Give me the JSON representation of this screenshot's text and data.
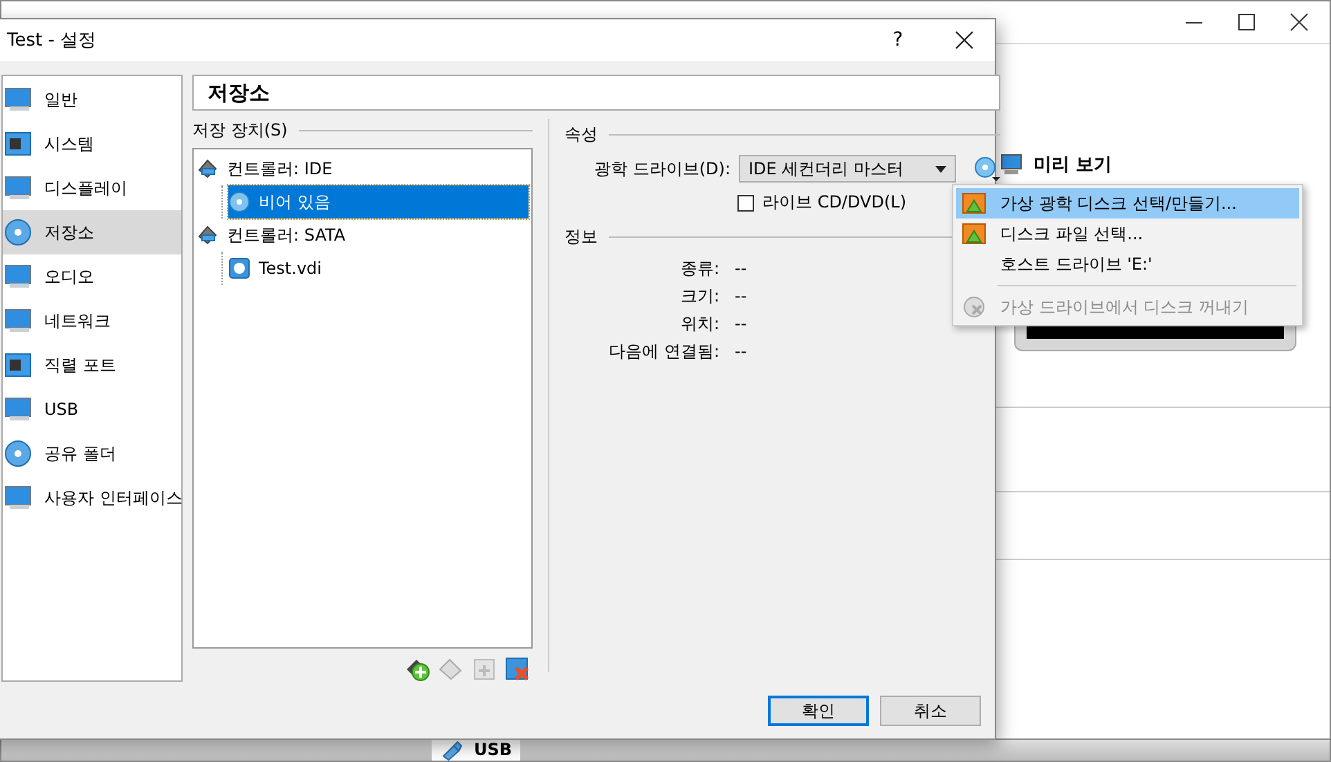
{
  "background_window": {
    "preview_title": "미리 보기",
    "status_item": "USB"
  },
  "dialog": {
    "title": "Test - 설정",
    "help": "?"
  },
  "sidebar": {
    "items": [
      {
        "label": "일반",
        "selected": false
      },
      {
        "label": "시스템",
        "selected": false
      },
      {
        "label": "디스플레이",
        "selected": false
      },
      {
        "label": "저장소",
        "selected": true
      },
      {
        "label": "오디오",
        "selected": false
      },
      {
        "label": "네트워크",
        "selected": false
      },
      {
        "label": "직렬 포트",
        "selected": false
      },
      {
        "label": "USB",
        "selected": false
      },
      {
        "label": "공유 폴더",
        "selected": false
      },
      {
        "label": "사용자 인터페이스",
        "selected": false
      }
    ]
  },
  "page_title": "저장소",
  "storage": {
    "label": "저장 장치(S)",
    "tree": [
      {
        "label": "컨트롤러: IDE",
        "kind": "controller",
        "selected": false,
        "children": [
          {
            "label": "비어 있음",
            "kind": "optical",
            "selected": true
          }
        ]
      },
      {
        "label": "컨트롤러: SATA",
        "kind": "controller",
        "selected": false,
        "children": [
          {
            "label": "Test.vdi",
            "kind": "disk",
            "selected": false
          }
        ]
      }
    ]
  },
  "attributes": {
    "label": "속성",
    "optical_drive": {
      "label": "광학 드라이브(D):",
      "value": "IDE 세컨더리 마스터"
    },
    "live_cd": {
      "label": "라이브 CD/DVD(L)",
      "checked": false
    }
  },
  "info": {
    "label": "정보",
    "rows": [
      {
        "label": "종류:",
        "value": "--"
      },
      {
        "label": "크기:",
        "value": "--"
      },
      {
        "label": "위치:",
        "value": "--"
      },
      {
        "label": "다음에 연결됨:",
        "value": "--"
      }
    ]
  },
  "menu": {
    "items": [
      {
        "label": "가상 광학 디스크 선택/만들기...",
        "kind": "file",
        "selected": true,
        "disabled": false
      },
      {
        "label": "디스크 파일 선택...",
        "kind": "file",
        "selected": false,
        "disabled": false
      },
      {
        "label": "호스트 드라이브 'E:'",
        "kind": "host",
        "selected": false,
        "disabled": false
      },
      {
        "label": "가상 드라이브에서 디스크 꺼내기",
        "kind": "eject",
        "selected": false,
        "disabled": true
      }
    ]
  },
  "buttons": [
    {
      "label": "확인",
      "default": true
    },
    {
      "label": "취소",
      "default": false
    }
  ]
}
